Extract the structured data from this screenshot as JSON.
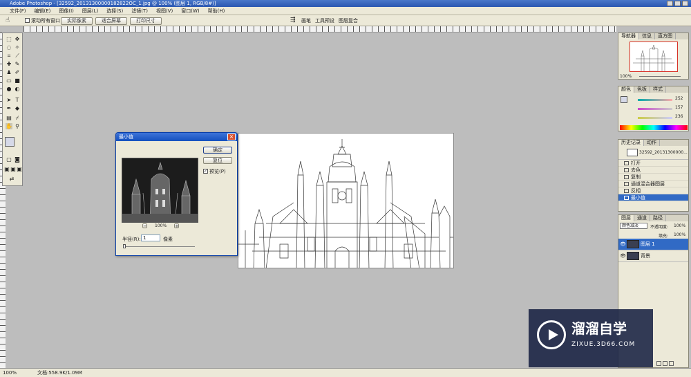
{
  "app": {
    "title": "Adobe Photoshop - [32592_20131300000182822OC_1.jpg @ 100% (图层 1, RGB/8#)]"
  },
  "menu": [
    "文件(F)",
    "编辑(E)",
    "图像(I)",
    "图层(L)",
    "选择(S)",
    "滤镜(T)",
    "视图(V)",
    "窗口(W)",
    "帮助(H)"
  ],
  "options": {
    "scroll_all_label": "滚动所有窗口",
    "actual_pixels": "实际像素",
    "fit_screen": "适合屏幕",
    "print_size": "打印尺寸",
    "right_tabs": [
      "画笔",
      "工具预设",
      "图层复合"
    ]
  },
  "dialog": {
    "title": "最小值",
    "ok": "确定",
    "reset": "复位",
    "preview_label": "预览(P)",
    "zoom": "100%",
    "radius_label": "半径(R):",
    "radius_value": "1",
    "unit": "像素"
  },
  "navigator": {
    "tabs": [
      "导航器",
      "信息",
      "直方图"
    ],
    "zoom": "100%"
  },
  "color": {
    "tabs": [
      "颜色",
      "色板",
      "样式"
    ],
    "r": "252",
    "g": "157",
    "b": "236"
  },
  "history": {
    "tabs": [
      "历史记录",
      "动作"
    ],
    "snapshot": "32592_20131300000...",
    "items": [
      "打开",
      "去色",
      "复制",
      "通道混合器图层",
      "反相",
      "最小值"
    ]
  },
  "layers": {
    "tabs": [
      "图层",
      "通道",
      "路径"
    ],
    "blend_mode": "颜色减淡",
    "opacity_label": "不透明度:",
    "opacity": "100%",
    "fill_label": "填充:",
    "fill": "100%",
    "items": [
      {
        "name": "图层 1"
      },
      {
        "name": "背景"
      }
    ]
  },
  "status": {
    "zoom": "100%",
    "doc": "文档:558.9K/1.09M"
  },
  "watermark": {
    "brand": "溜溜自学",
    "url": "ZIXUE.3D66.COM"
  },
  "colors": {
    "title_blue": "#2a57b1",
    "selection_blue": "#316ac5",
    "workspace_gray": "#bdbdbd",
    "panel_bg": "#ece9d8"
  }
}
